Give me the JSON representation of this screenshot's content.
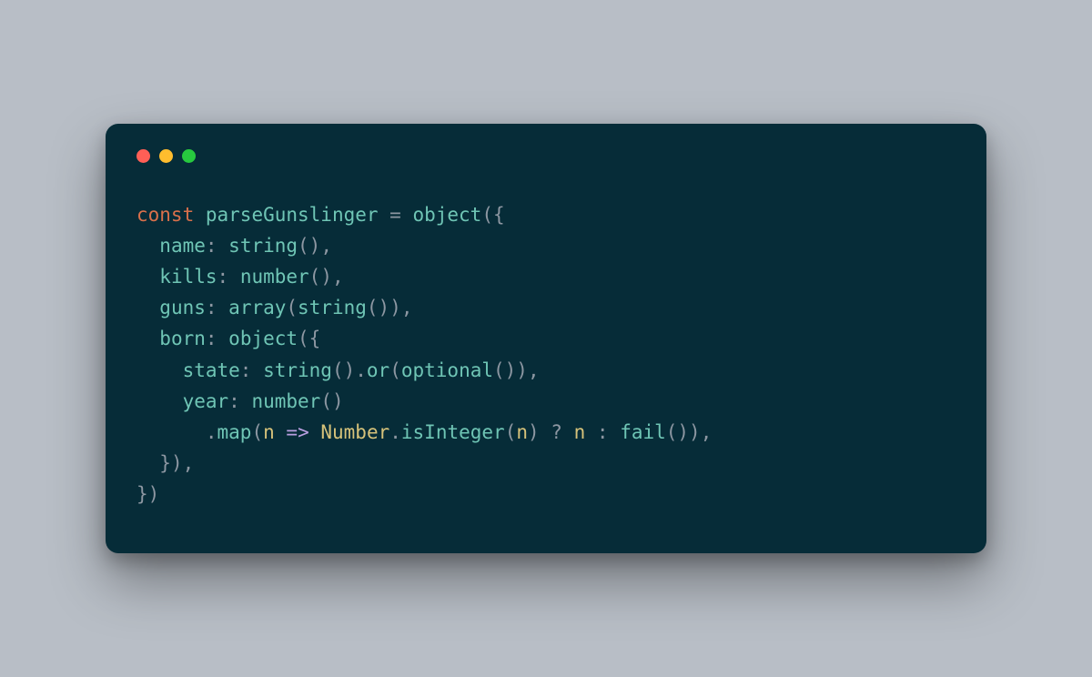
{
  "code": {
    "kw_const": "const",
    "id_parseGunslinger": "parseGunslinger",
    "fn_object": "object",
    "prop_name": "name",
    "fn_string": "string",
    "prop_kills": "kills",
    "fn_number": "number",
    "prop_guns": "guns",
    "fn_array": "array",
    "prop_born": "born",
    "prop_state": "state",
    "fn_or": "or",
    "fn_optional": "optional",
    "prop_year": "year",
    "fn_map": "map",
    "param_n": "n",
    "arrow": "=>",
    "cls_Number": "Number",
    "fn_isInteger": "isInteger",
    "fn_fail": "fail",
    "p_eq": " = ",
    "p_open_obj": "({",
    "p_close_obj": "})",
    "p_open_paren": "(",
    "p_close_paren": ")",
    "p_call": "()",
    "p_call_comma": "(),",
    "p_close_paren_comma": "),",
    "p_close_call_comma": "()),",
    "p_colon": ": ",
    "p_dot": ".",
    "p_q": " ? ",
    "p_col": " : ",
    "p_sp": " ",
    "p_close_obj_comma": "}),"
  }
}
